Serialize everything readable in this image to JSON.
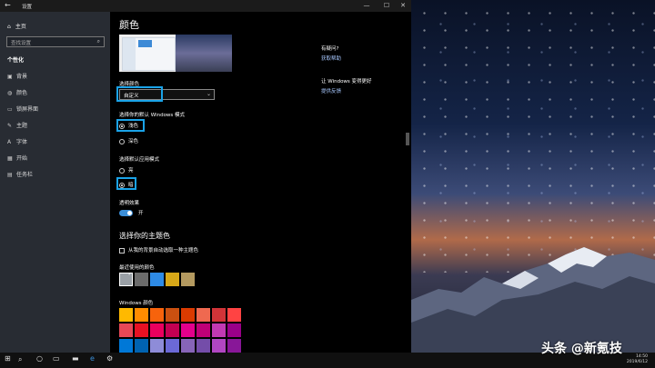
{
  "window": {
    "title": "设置",
    "back_glyph": "←",
    "minimize_glyph": "—",
    "maximize_glyph": "☐",
    "close_glyph": "✕"
  },
  "sidebar": {
    "home": "主页",
    "search_placeholder": "查找设置",
    "section": "个性化",
    "items": [
      {
        "label": "背景",
        "icon": "picture-icon",
        "glyph": "▣"
      },
      {
        "label": "颜色",
        "icon": "palette-icon",
        "glyph": "◍"
      },
      {
        "label": "锁屏界面",
        "icon": "lock-screen-icon",
        "glyph": "▭"
      },
      {
        "label": "主题",
        "icon": "brush-icon",
        "glyph": "✎"
      },
      {
        "label": "字体",
        "icon": "font-icon",
        "glyph": "A"
      },
      {
        "label": "开始",
        "icon": "start-icon",
        "glyph": "▦"
      },
      {
        "label": "任务栏",
        "icon": "taskbar-icon",
        "glyph": "▤"
      }
    ]
  },
  "main": {
    "title": "颜色",
    "choose_color_label": "选择颜色",
    "choose_color_value": "自定义",
    "windows_mode_label": "选择你的默认 Windows 模式",
    "windows_mode_options": [
      "浅色",
      "深色"
    ],
    "app_mode_label": "选择默认应用模式",
    "app_mode_options": [
      "亮",
      "暗"
    ],
    "transparency_label": "透明效果",
    "transparency_state": "开",
    "accent_title": "选择你的主题色",
    "auto_accent_label": "从我的背景自动选取一种主题色",
    "recent_colors_label": "最近使用的颜色",
    "recent_colors": [
      "#9aa0a6",
      "#6b6b6b",
      "#2e8be6",
      "#d8a818",
      "#b49a60"
    ],
    "windows_colors_label": "Windows 颜色",
    "windows_colors": [
      [
        "#ffb900",
        "#ff8c00",
        "#f7630c",
        "#ca5010",
        "#da3b01",
        "#ef6950",
        "#d13438",
        "#ff4343"
      ],
      [
        "#e74856",
        "#e81123",
        "#ea005e",
        "#c30052",
        "#e3008c",
        "#bf0077",
        "#c239b3",
        "#9a0089"
      ],
      [
        "#0078d7",
        "#0063b1",
        "#8e8cd8",
        "#6b69d6",
        "#8764b8",
        "#744da9",
        "#b146c2",
        "#881798"
      ]
    ]
  },
  "help": {
    "q1": "有疑问?",
    "a1": "获取帮助",
    "q2": "让 Windows 变得更好",
    "a2": "提供反馈"
  },
  "taskbar": {
    "time": "14:50",
    "date": "2019/6/12"
  },
  "watermark": "头条 @新氪技"
}
